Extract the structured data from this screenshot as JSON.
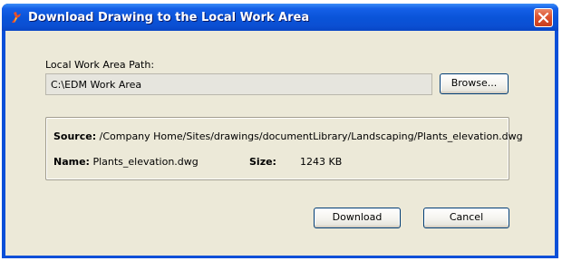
{
  "window": {
    "title": "Download Drawing to the Local Work Area",
    "icon": "app-logo-icon",
    "close_icon": "close-icon"
  },
  "path_section": {
    "label": "Local Work Area Path:",
    "value": "C:\\EDM Work Area",
    "browse_label": "Browse..."
  },
  "info": {
    "source_label": "Source:",
    "source_value": "/Company Home/Sites/drawings/documentLibrary/Landscaping/Plants_elevation.dwg",
    "name_label": "Name:",
    "name_value": "Plants_elevation.dwg",
    "size_label": "Size:",
    "size_value": "1243 KB"
  },
  "buttons": {
    "download_label": "Download",
    "cancel_label": "Cancel"
  },
  "colors": {
    "titlebar": "#0a54d9",
    "dialog_bg": "#ece9d8",
    "close_button": "#dd5330"
  }
}
